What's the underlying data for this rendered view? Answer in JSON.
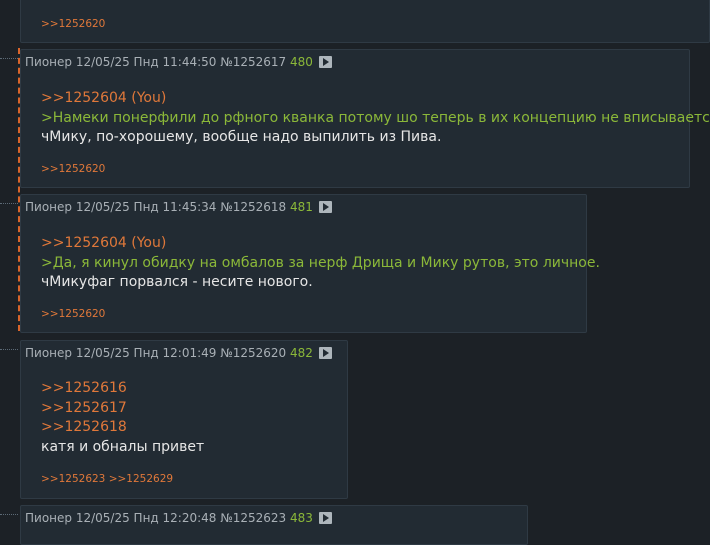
{
  "top_post": {
    "replies": ">>1252620"
  },
  "posts": [
    {
      "author": "Пионер",
      "date": "12/05/25 Пнд 11:44:50",
      "id": "№1252617",
      "number": "480",
      "reply_to": ">>1252604 (You)",
      "quote": ">Намеки понерфили до рфного кванка потому шо теперь в их концепцию не вписывается",
      "text": "чМику, по-хорошему, вообще надо выпилить из Пива.",
      "replies": ">>1252620"
    },
    {
      "author": "Пионер",
      "date": "12/05/25 Пнд 11:45:34",
      "id": "№1252618",
      "number": "481",
      "reply_to": ">>1252604 (You)",
      "quote": ">Да, я кинул обидку на омбалов за нерф Дрища и Мику рутов, это личное.",
      "text": "чМикуфаг порвался - несите нового.",
      "replies": ">>1252620"
    },
    {
      "author": "Пионер",
      "date": "12/05/25 Пнд 12:01:49",
      "id": "№1252620",
      "number": "482",
      "links": [
        ">>1252616",
        ">>1252617",
        ">>1252618"
      ],
      "text": "катя и обналы привет",
      "replies": ">>1252623 >>1252629"
    },
    {
      "author": "Пионер",
      "date": "12/05/25 Пнд 12:20:48",
      "id": "№1252623",
      "number": "483"
    }
  ]
}
